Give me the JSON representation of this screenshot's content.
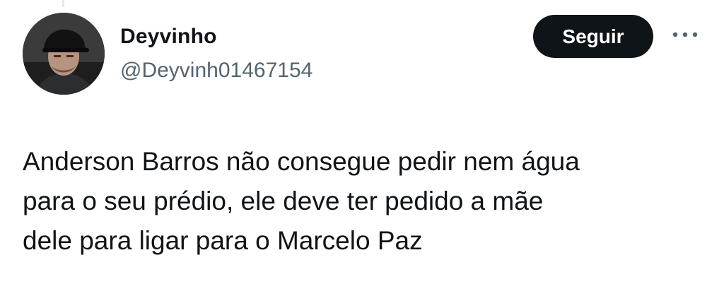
{
  "tweet": {
    "author": {
      "display_name": "Deyvinho",
      "handle": "@Deyvinh01467154"
    },
    "follow_label": "Seguir",
    "more_icon": "more-horizontal-icon",
    "text": "Anderson Barros não consegue pedir nem água\npara o seu prédio, ele deve ter pedido a mãe\ndele para ligar para o Marcelo Paz"
  },
  "colors": {
    "text": "#0f1419",
    "secondary_text": "#536471",
    "button_bg": "#0f1419",
    "button_text": "#ffffff"
  }
}
